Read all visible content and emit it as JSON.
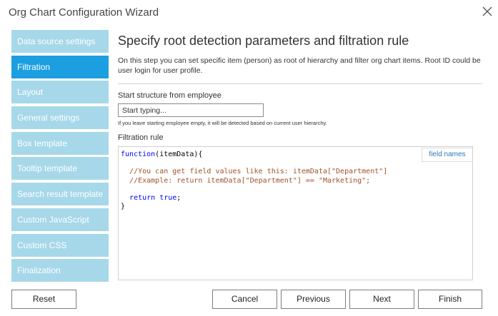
{
  "window": {
    "title": "Org Chart Configuration Wizard",
    "close_icon": "close-icon"
  },
  "nav": {
    "items": [
      {
        "label": "Data source settings",
        "active": false
      },
      {
        "label": "Filtration",
        "active": true
      },
      {
        "label": "Layout",
        "active": false
      },
      {
        "label": "General settings",
        "active": false
      },
      {
        "label": "Box template",
        "active": false
      },
      {
        "label": "Tooltip template",
        "active": false
      },
      {
        "label": "Search result template",
        "active": false
      },
      {
        "label": "Custom JavaScript",
        "active": false
      },
      {
        "label": "Custom CSS",
        "active": false
      },
      {
        "label": "Finalization",
        "active": false
      }
    ]
  },
  "main": {
    "heading": "Specify root detection parameters and filtration rule",
    "description": "On this step you can set specific item (person) as root of hierarchy and filter org chart items. Root ID could be user login for user profile.",
    "start_label": "Start structure from employee",
    "start_placeholder": "Start typing...",
    "start_hint": "If you leave starting employee empty, it will be detected based on current user hierarchy.",
    "filter_label": "Filtration rule",
    "field_names_link": "field names",
    "code": {
      "line1_kw": "function",
      "line1_rest": "(itemData){",
      "line2": "//You can get field values like this: itemData[\"Department\"]",
      "line3": "//Example: return itemData[\"Department\"] == \"Marketing\";",
      "line4_kw1": "return",
      "line4_kw2": "true",
      "line4_end": ";",
      "line5": "}"
    }
  },
  "buttons": {
    "reset": "Reset",
    "cancel": "Cancel",
    "previous": "Previous",
    "next": "Next",
    "finish": "Finish"
  },
  "colors": {
    "nav_inactive": "#a6d8ea",
    "nav_active": "#1b9fe0",
    "keyword": "#0000ff",
    "comment": "#a0522d",
    "link": "#2a7ab8"
  }
}
